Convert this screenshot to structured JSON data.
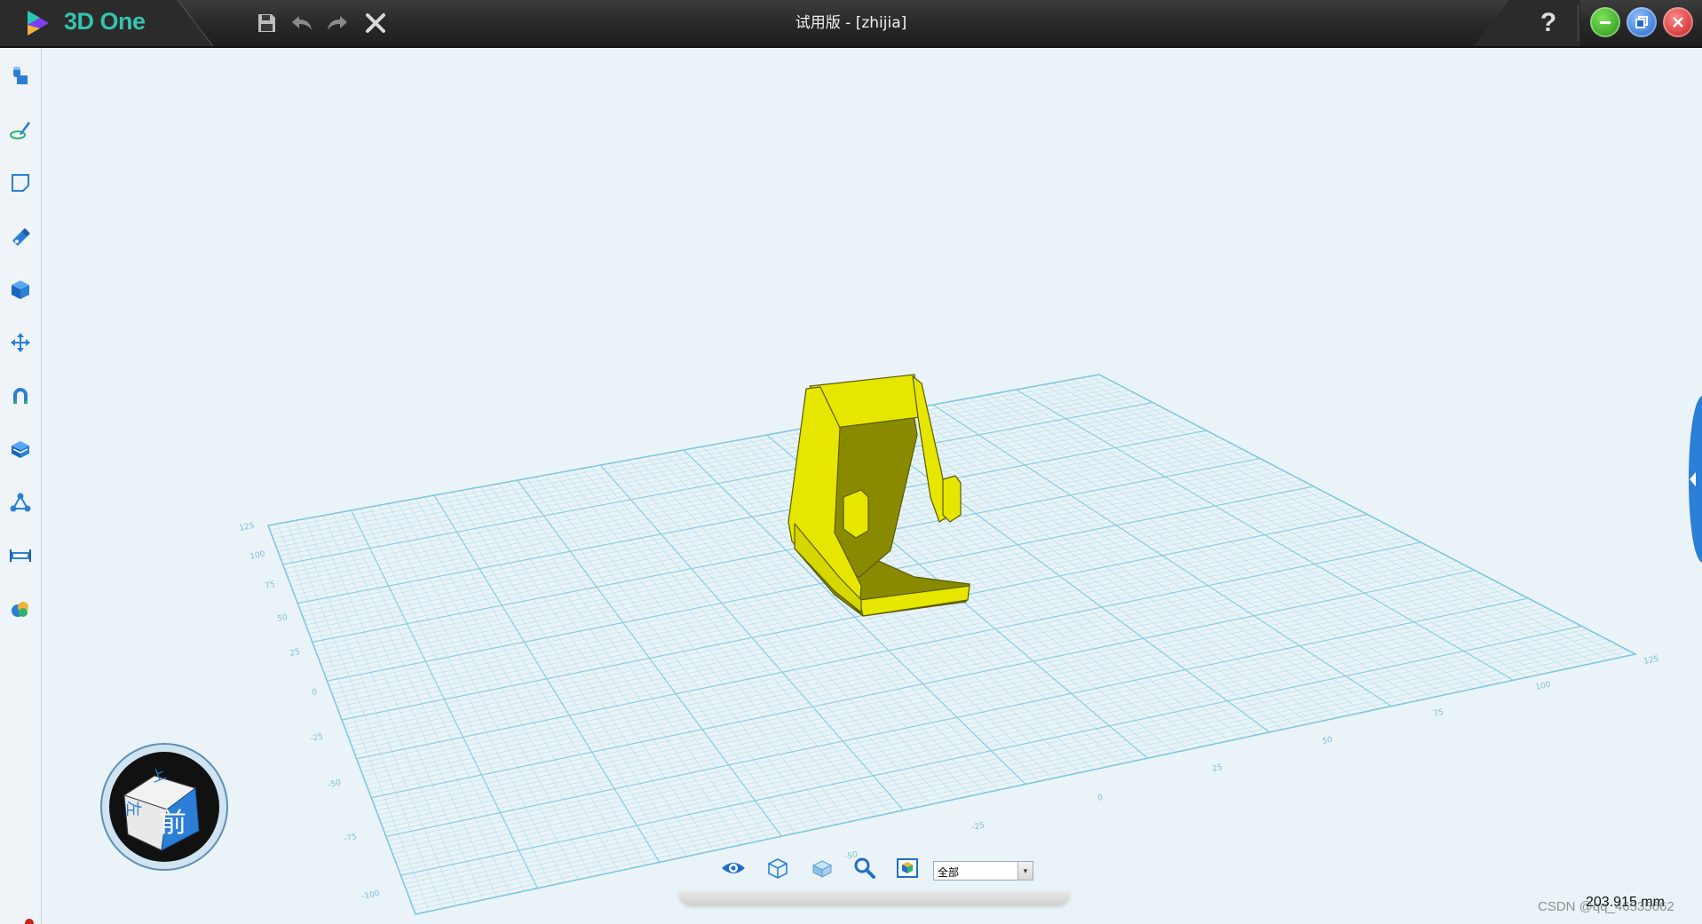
{
  "app": {
    "name": "3D One",
    "window_title": "试用版 - [zhijia]"
  },
  "toolbar": {
    "save_icon": "save-icon",
    "undo_icon": "undo-icon",
    "redo_icon": "redo-icon",
    "delete_icon": "close-x-icon"
  },
  "window_controls": {
    "help_label": "?",
    "minimize": "minimize-icon",
    "restore": "restore-icon",
    "close": "close-icon"
  },
  "sidebar": {
    "items": [
      {
        "name": "basic-solid-tool",
        "icon": "solid-primitives-icon"
      },
      {
        "name": "sketch-tool",
        "icon": "sketch-pen-icon"
      },
      {
        "name": "sketch-edit-tool",
        "icon": "sketch-square-icon"
      },
      {
        "name": "special-function-tool",
        "icon": "brush-icon"
      },
      {
        "name": "feature-modeling-tool",
        "icon": "cube-icon"
      },
      {
        "name": "move-tool",
        "icon": "move-arrows-icon"
      },
      {
        "name": "snap-tool",
        "icon": "magnet-icon"
      },
      {
        "name": "combine-tool",
        "icon": "layers-icon"
      },
      {
        "name": "pattern-tool",
        "icon": "nodes-icon"
      },
      {
        "name": "measure-tool",
        "icon": "ruler-icon"
      },
      {
        "name": "material-tool",
        "icon": "color-palette-icon"
      }
    ]
  },
  "view_cube": {
    "front_label": "前",
    "top_label": "上",
    "left_label": "左"
  },
  "grid": {
    "left_axis_labels": [
      "125",
      "100",
      "75",
      "50",
      "25",
      "0",
      "-25",
      "-50",
      "-75",
      "-100"
    ],
    "bottom_axis_labels": [
      "-50",
      "-25",
      "0",
      "25",
      "50",
      "75",
      "100",
      "125"
    ]
  },
  "bottom_bar": {
    "view_icon": "eye-icon",
    "wireframe_icon": "wireframe-cube-icon",
    "shaded_icon": "shaded-cube-icon",
    "zoom_icon": "zoom-icon",
    "render_icon": "render-mode-icon",
    "filter_value": "全部"
  },
  "status": {
    "measurement": "203.915 mm",
    "watermark": "CSDN @qq_46535662"
  },
  "colors": {
    "model": "#e6e600",
    "model_dark": "#8a8a00",
    "grid_line": "#8fd0e6",
    "accent": "#2c7fd6"
  }
}
